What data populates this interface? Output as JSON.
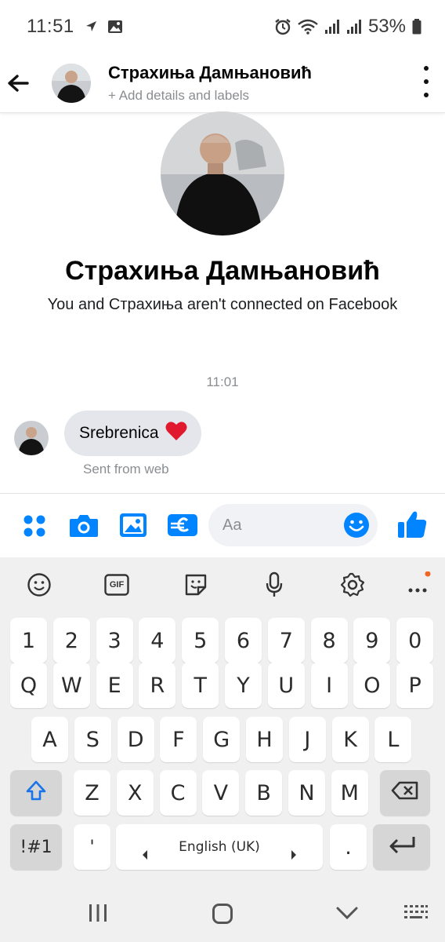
{
  "status_bar": {
    "time": "11:51",
    "battery": "53%",
    "icons": [
      "navigation-arrow-icon",
      "gallery-icon",
      "alarm-icon",
      "wifi-icon",
      "signal-icon",
      "signal-icon",
      "battery-icon"
    ]
  },
  "header": {
    "name": "Страхиња Дамњановић",
    "subtitle": "+ Add details and labels"
  },
  "profile": {
    "name": "Страхиња Дамњановић",
    "connection_note": "You and Страхиња aren't connected on Facebook"
  },
  "conversation": {
    "timestamp": "11:01",
    "messages": [
      {
        "text": "Srebrenica",
        "emoji": "heart",
        "meta": "Sent from web"
      }
    ]
  },
  "composer": {
    "placeholder": "Aa",
    "icons": [
      "apps-icon",
      "camera-icon",
      "image-icon",
      "pay-icon",
      "emoji-icon",
      "like-icon"
    ],
    "accent": "#0084ff"
  },
  "keyboard": {
    "toolbar": [
      "emoji-icon",
      "GIF",
      "sticker-icon",
      "mic-icon",
      "settings-icon",
      "more-icon"
    ],
    "gif_label": "GIF",
    "rows": [
      [
        "1",
        "2",
        "3",
        "4",
        "5",
        "6",
        "7",
        "8",
        "9",
        "0"
      ],
      [
        "Q",
        "W",
        "E",
        "R",
        "T",
        "Y",
        "U",
        "I",
        "O",
        "P"
      ],
      [
        "A",
        "S",
        "D",
        "F",
        "G",
        "H",
        "J",
        "K",
        "L"
      ],
      [
        "Z",
        "X",
        "C",
        "V",
        "B",
        "N",
        "M"
      ]
    ],
    "symbols_label": "!#1",
    "apostrophe": "'",
    "language": "English (UK)",
    "period": "."
  },
  "nav_bar": [
    "recents-icon",
    "home-icon",
    "back-icon",
    "keyboard-icon"
  ]
}
